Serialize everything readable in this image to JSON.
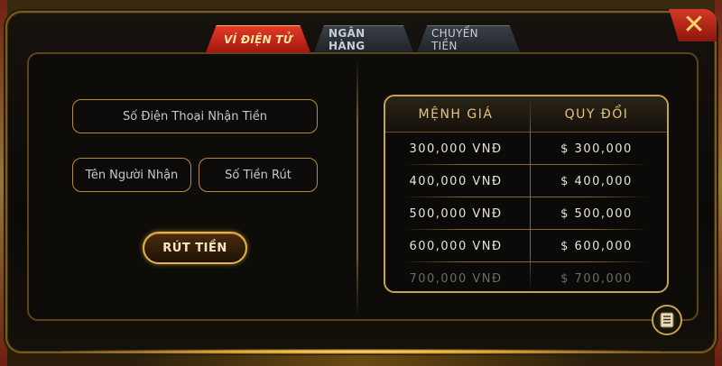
{
  "tabs": [
    {
      "label": "VÍ ĐIỆN TỬ",
      "active": true
    },
    {
      "label": "NGÂN HÀNG",
      "active": false
    },
    {
      "label": "CHUYỂN TIỀN",
      "active": false
    }
  ],
  "form": {
    "phone_placeholder": "Số Điện Thoại Nhận Tiền",
    "name_placeholder": "Tên Người Nhận",
    "amount_placeholder": "Số Tiền Rút",
    "submit_label": "RÚT TIỀN"
  },
  "rate_table": {
    "header_denomination": "MỆNH GIÁ",
    "header_exchange": "QUY ĐỔI",
    "rows": [
      {
        "denomination": "300,000 VNĐ",
        "exchange": "$ 300,000"
      },
      {
        "denomination": "400,000 VNĐ",
        "exchange": "$ 400,000"
      },
      {
        "denomination": "500,000 VNĐ",
        "exchange": "$ 500,000"
      },
      {
        "denomination": "600,000 VNĐ",
        "exchange": "$ 600,000"
      },
      {
        "denomination": "700,000 VNĐ",
        "exchange": "$ 700,000"
      }
    ]
  },
  "icons": {
    "close": "close-icon",
    "notes": "notes-icon"
  },
  "colors": {
    "accent_gold": "#c9a24a",
    "tab_active_red": "#c4231a",
    "close_red": "#d63a26"
  }
}
